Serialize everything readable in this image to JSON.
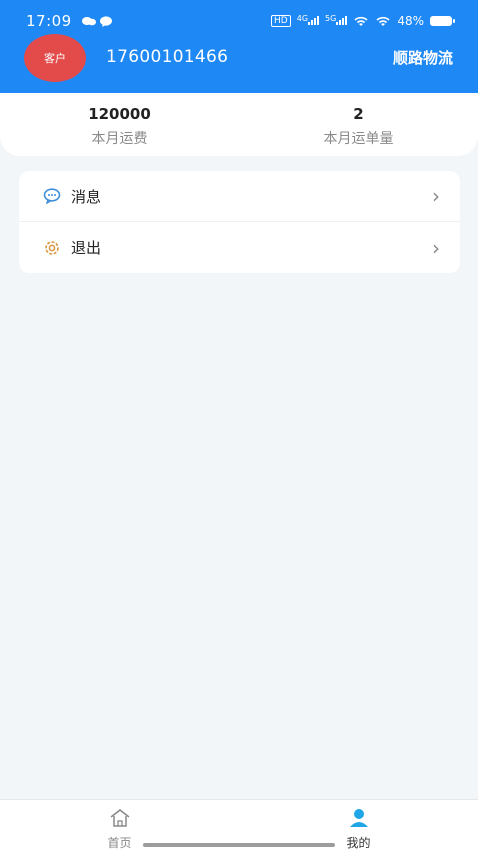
{
  "status_bar": {
    "time": "17:09",
    "battery": "48%",
    "network_4g": "4G",
    "network_5g": "5G",
    "hd": "HD"
  },
  "header": {
    "avatar_label": "客户",
    "phone": "17600101466",
    "company": "顺路物流",
    "background_color": "#1e88f5",
    "avatar_color": "#e34b4b"
  },
  "stats": [
    {
      "value": "120000",
      "label": "本月运费"
    },
    {
      "value": "2",
      "label": "本月运单量"
    }
  ],
  "menu": [
    {
      "label": "消息",
      "icon": "message-icon",
      "arrow": "›"
    },
    {
      "label": "退出",
      "icon": "gear-icon",
      "arrow": "›"
    }
  ],
  "tabbar": {
    "tabs": [
      {
        "label": "首页",
        "icon": "home-icon",
        "active": false
      },
      {
        "label": "我的",
        "icon": "user-icon",
        "active": true
      }
    ],
    "active_color": "#1ea6e6"
  }
}
